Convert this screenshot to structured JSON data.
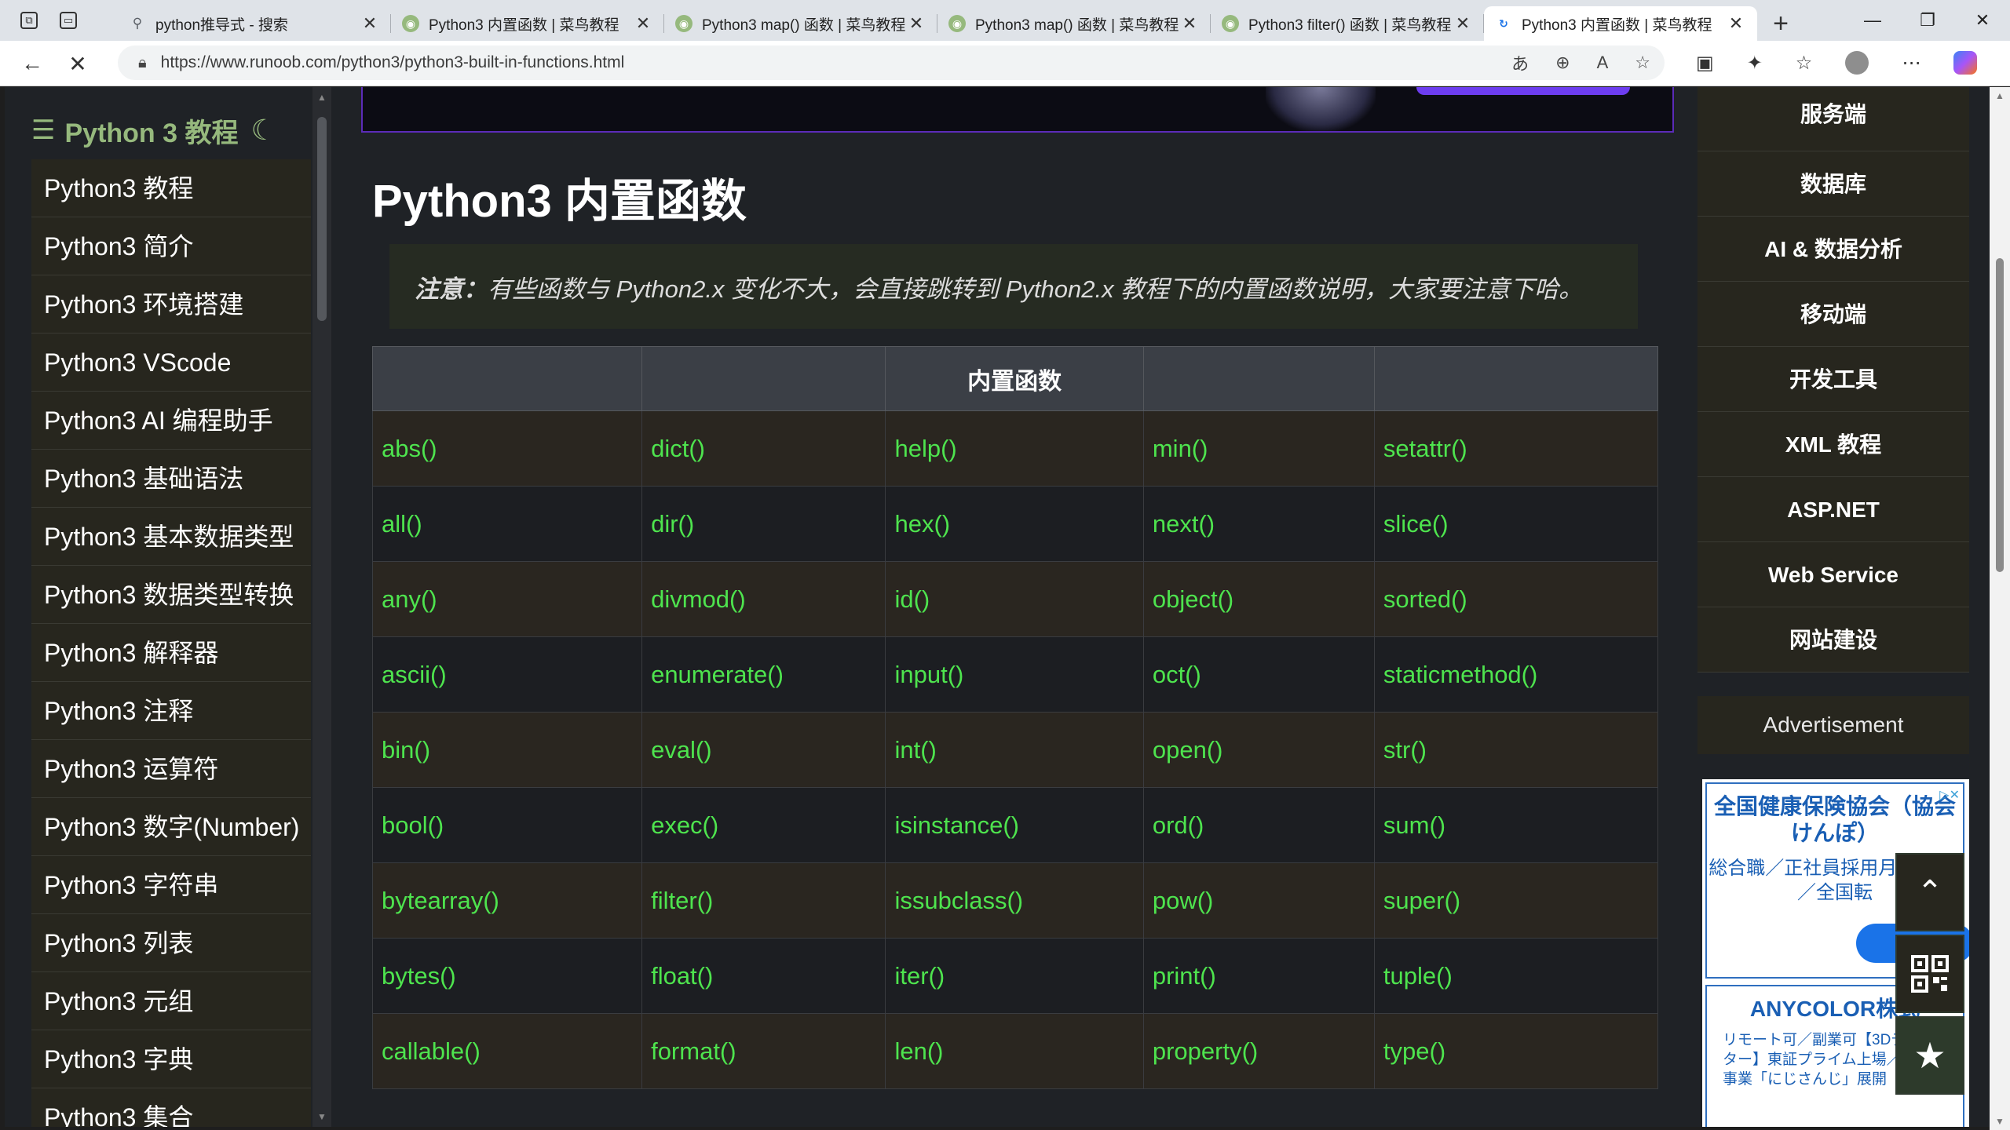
{
  "tabs": [
    {
      "title": "python推导式 - 搜索",
      "icon": "search-icon"
    },
    {
      "title": "Python3 内置函数 | 菜鸟教程",
      "icon": "runoob-icon"
    },
    {
      "title": "Python3 map() 函数 | 菜鸟教程",
      "icon": "runoob-icon"
    },
    {
      "title": "Python3 map() 函数 | 菜鸟教程",
      "icon": "runoob-icon"
    },
    {
      "title": "Python3 filter() 函数 | 菜鸟教程",
      "icon": "runoob-icon"
    },
    {
      "title": "Python3 内置函数 | 菜鸟教程",
      "icon": "loading-icon",
      "active": true
    }
  ],
  "address": {
    "url": "https://www.runoob.com/python3/python3-built-in-functions.html"
  },
  "sidebar": {
    "header": "Python 3 教程",
    "items": [
      "Python3 教程",
      "Python3 简介",
      "Python3 环境搭建",
      "Python3 VScode",
      "Python3 AI 编程助手",
      "Python3 基础语法",
      "Python3 基本数据类型",
      "Python3 数据类型转换",
      "Python3 解释器",
      "Python3 注释",
      "Python3 运算符",
      "Python3 数字(Number)",
      "Python3 字符串",
      "Python3 列表",
      "Python3 元组",
      "Python3 字典",
      "Python3 集合"
    ]
  },
  "main": {
    "title": "Python3 内置函数",
    "note_label": "注意：",
    "note_text": "有些函数与 Python2.x 变化不大，会直接跳转到 Python2.x 教程下的内置函数说明，大家要注意下哈。",
    "table": {
      "header": "内置函数",
      "rows": [
        [
          "abs()",
          "dict()",
          "help()",
          "min()",
          "setattr()"
        ],
        [
          "all()",
          "dir()",
          "hex()",
          "next()",
          "slice()"
        ],
        [
          "any()",
          "divmod()",
          "id()",
          "object()",
          "sorted()"
        ],
        [
          "ascii()",
          "enumerate()",
          "input()",
          "oct()",
          "staticmethod()"
        ],
        [
          "bin()",
          "eval()",
          "int()",
          "open()",
          "str()"
        ],
        [
          "bool()",
          "exec()",
          "isinstance()",
          "ord()",
          "sum()"
        ],
        [
          "bytearray()",
          "filter()",
          "issubclass()",
          "pow()",
          "super()"
        ],
        [
          "bytes()",
          "float()",
          "iter()",
          "print()",
          "tuple()"
        ],
        [
          "callable()",
          "format()",
          "len()",
          "property()",
          "type()"
        ]
      ]
    }
  },
  "right_sidebar": {
    "categories": [
      "服务端",
      "数据库",
      "AI & 数据分析",
      "移动端",
      "开发工具",
      "XML 教程",
      "ASP.NET",
      "Web Service",
      "网站建设"
    ],
    "ad_label": "Advertisement",
    "ads": [
      {
        "title": "全国健康保険協会（協会けんぽ）",
        "body": "総合職／正社員採用月4.3時間／全国転"
      },
      {
        "title": "ANYCOLOR株式",
        "body": "リモート可／副業可【3Dディレクター】東証プライム上場／VTuber事業「にじさんじ」展開"
      }
    ]
  },
  "colors": {
    "accent_green": "#96b97d",
    "link_green": "#4ee44e",
    "sidebar_item_bg": "#27261e",
    "page_bg": "#1f2226"
  }
}
